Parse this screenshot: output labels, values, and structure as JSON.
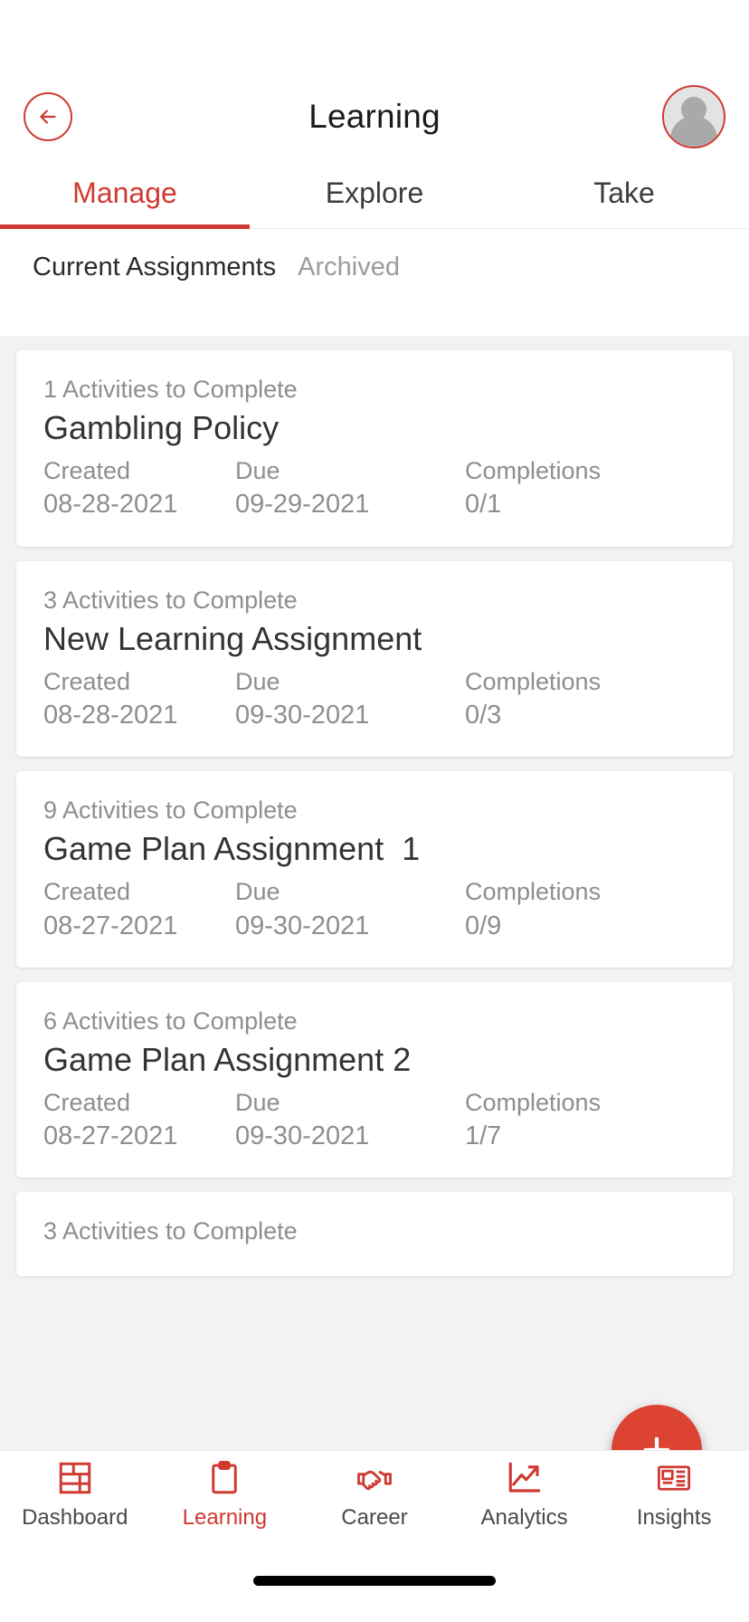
{
  "colors": {
    "accent": "#cf3a32",
    "fab": "#dd4333",
    "muted": "#8e8e8e",
    "dark": "#333333"
  },
  "header": {
    "title": "Learning",
    "back_icon": "arrow-left-icon",
    "avatar_icon": "user-avatar-icon"
  },
  "tabs": [
    {
      "label": "Manage",
      "active": true
    },
    {
      "label": "Explore",
      "active": false
    },
    {
      "label": "Take",
      "active": false
    }
  ],
  "subtabs": [
    {
      "label": "Current Assignments",
      "active": true
    },
    {
      "label": "Archived",
      "active": false
    }
  ],
  "meta_labels": {
    "created": "Created",
    "due": "Due",
    "completions": "Completions"
  },
  "cards": [
    {
      "activities": "1 Activities to Complete",
      "title": "Gambling Policy",
      "created": "08-28-2021",
      "due": "09-29-2021",
      "completions": "0/1"
    },
    {
      "activities": "3 Activities to Complete",
      "title": "New Learning Assignment",
      "created": "08-28-2021",
      "due": "09-30-2021",
      "completions": "0/3"
    },
    {
      "activities": "9 Activities to Complete",
      "title": "Game Plan Assignment  1",
      "created": "08-27-2021",
      "due": "09-30-2021",
      "completions": "0/9"
    },
    {
      "activities": "6 Activities to Complete",
      "title": "Game Plan Assignment 2",
      "created": "08-27-2021",
      "due": "09-30-2021",
      "completions": "1/7"
    },
    {
      "activities": "3 Activities to Complete",
      "title": "",
      "created": "",
      "due": "",
      "completions": ""
    }
  ],
  "fab": {
    "icon": "plus-icon",
    "label": "+"
  },
  "bottomnav": [
    {
      "label": "Dashboard",
      "icon": "dashboard-grid-icon",
      "active": false
    },
    {
      "label": "Learning",
      "icon": "clipboard-icon",
      "active": true
    },
    {
      "label": "Career",
      "icon": "handshake-icon",
      "active": false
    },
    {
      "label": "Analytics",
      "icon": "line-chart-icon",
      "active": false
    },
    {
      "label": "Insights",
      "icon": "newspaper-icon",
      "active": false
    }
  ]
}
